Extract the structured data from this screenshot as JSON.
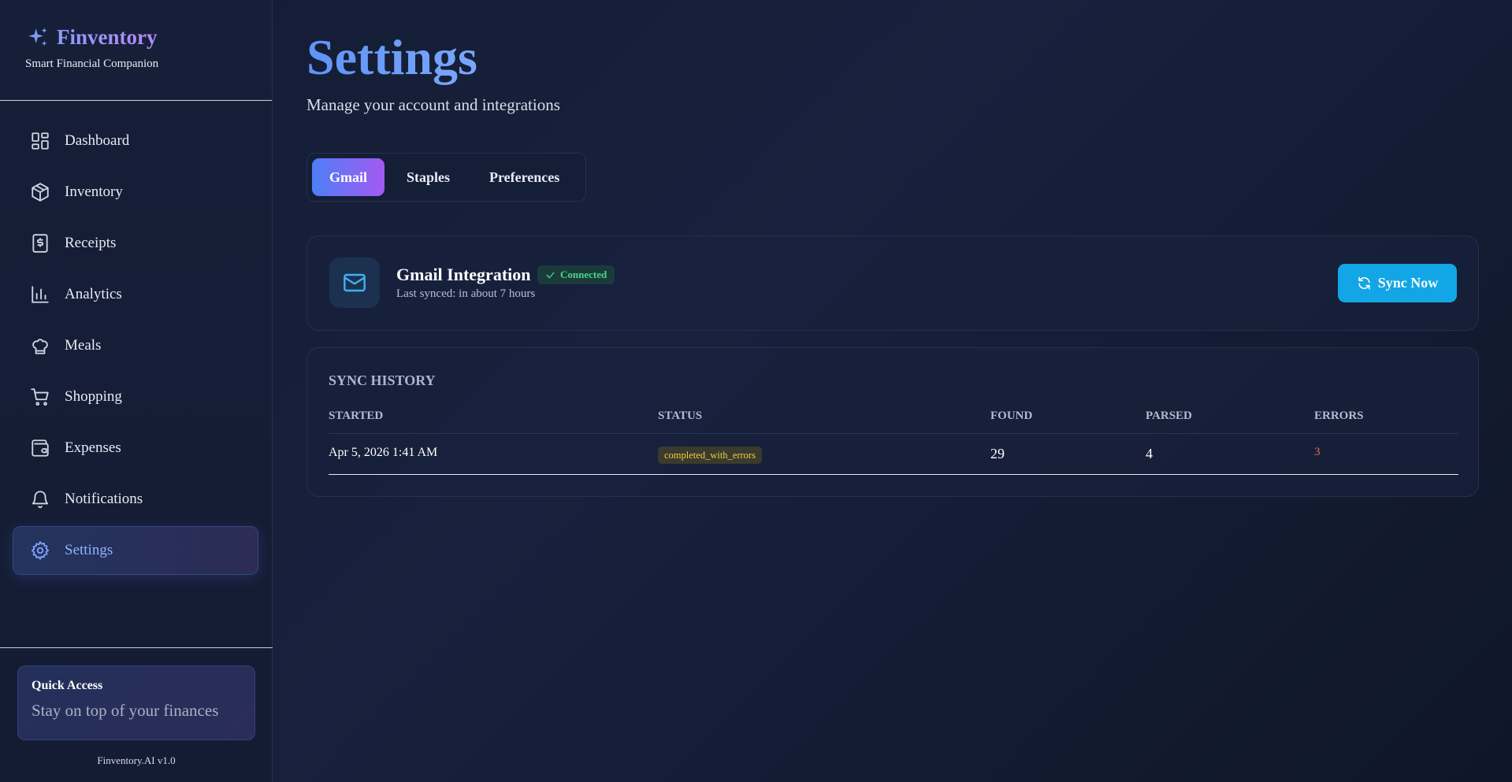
{
  "brand": {
    "name": "Finventory",
    "tagline": "Smart Financial Companion"
  },
  "sidebar": {
    "items": [
      {
        "label": "Dashboard",
        "icon": "dashboard-icon"
      },
      {
        "label": "Inventory",
        "icon": "box-icon"
      },
      {
        "label": "Receipts",
        "icon": "receipt-icon"
      },
      {
        "label": "Analytics",
        "icon": "bar-chart-icon"
      },
      {
        "label": "Meals",
        "icon": "chef-hat-icon"
      },
      {
        "label": "Shopping",
        "icon": "cart-icon"
      },
      {
        "label": "Expenses",
        "icon": "wallet-icon"
      },
      {
        "label": "Notifications",
        "icon": "bell-icon"
      },
      {
        "label": "Settings",
        "icon": "gear-icon",
        "active": true
      }
    ],
    "quick_access": {
      "title": "Quick Access",
      "text": "Stay on top of your finances"
    },
    "version": "Finventory.AI v1.0"
  },
  "page": {
    "title": "Settings",
    "subtitle": "Manage your account and integrations"
  },
  "tabs": [
    {
      "label": "Gmail",
      "active": true
    },
    {
      "label": "Staples",
      "active": false
    },
    {
      "label": "Preferences",
      "active": false
    }
  ],
  "gmail": {
    "title": "Gmail Integration",
    "status": "Connected",
    "last_synced": "Last synced: in about 7 hours",
    "sync_button": "Sync Now"
  },
  "history": {
    "title": "SYNC HISTORY",
    "columns": [
      "STARTED",
      "STATUS",
      "FOUND",
      "PARSED",
      "ERRORS"
    ],
    "rows": [
      {
        "started": "Apr 5, 2026 1:41 AM",
        "status": "completed_with_errors",
        "found": "29",
        "parsed": "4",
        "errors": "3"
      }
    ]
  },
  "colors": {
    "accent_blue": "#5f93f5",
    "tab_gradient_start": "#4d7ff5",
    "tab_gradient_end": "#a35af2",
    "sync_button": "#12a6e6",
    "connected_green": "#4ad58b",
    "status_warning": "#f3cd3a",
    "error_red": "#f0675c"
  }
}
